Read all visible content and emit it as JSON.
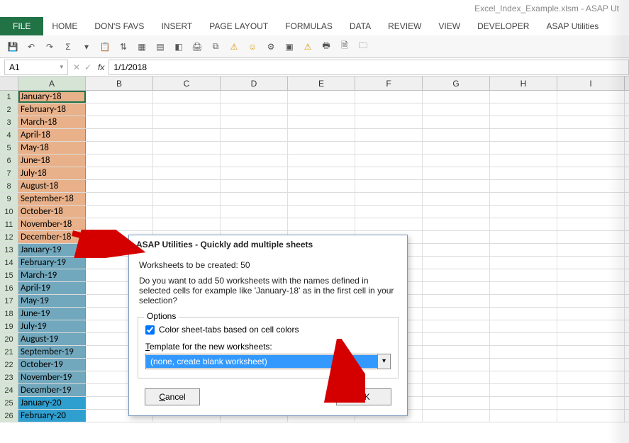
{
  "window": {
    "title": "Excel_Index_Example.xlsm - ASAP Ut"
  },
  "ribbon": {
    "tabs": [
      "FILE",
      "HOME",
      "DON'S FAVS",
      "INSERT",
      "PAGE LAYOUT",
      "FORMULAS",
      "DATA",
      "REVIEW",
      "VIEW",
      "DEVELOPER",
      "ASAP Utilities"
    ]
  },
  "formula": {
    "namebox": "A1",
    "fx_label": "fx",
    "value": "1/1/2018"
  },
  "columns": [
    "A",
    "B",
    "C",
    "D",
    "E",
    "F",
    "G",
    "H",
    "I"
  ],
  "rows": [
    {
      "n": 1,
      "v": "January-18",
      "c": "orange",
      "active": true
    },
    {
      "n": 2,
      "v": "February-18",
      "c": "orange"
    },
    {
      "n": 3,
      "v": "March-18",
      "c": "orange"
    },
    {
      "n": 4,
      "v": "April-18",
      "c": "orange"
    },
    {
      "n": 5,
      "v": "May-18",
      "c": "orange"
    },
    {
      "n": 6,
      "v": "June-18",
      "c": "orange"
    },
    {
      "n": 7,
      "v": "July-18",
      "c": "orange"
    },
    {
      "n": 8,
      "v": "August-18",
      "c": "orange"
    },
    {
      "n": 9,
      "v": "September-18",
      "c": "orange"
    },
    {
      "n": 10,
      "v": "October-18",
      "c": "orange"
    },
    {
      "n": 11,
      "v": "November-18",
      "c": "orange"
    },
    {
      "n": 12,
      "v": "December-18",
      "c": "orange"
    },
    {
      "n": 13,
      "v": "January-19",
      "c": "blue1"
    },
    {
      "n": 14,
      "v": "February-19",
      "c": "blue1"
    },
    {
      "n": 15,
      "v": "March-19",
      "c": "blue1"
    },
    {
      "n": 16,
      "v": "April-19",
      "c": "blue1"
    },
    {
      "n": 17,
      "v": "May-19",
      "c": "blue1"
    },
    {
      "n": 18,
      "v": "June-19",
      "c": "blue1"
    },
    {
      "n": 19,
      "v": "July-19",
      "c": "blue1"
    },
    {
      "n": 20,
      "v": "August-19",
      "c": "blue1"
    },
    {
      "n": 21,
      "v": "September-19",
      "c": "blue1"
    },
    {
      "n": 22,
      "v": "October-19",
      "c": "blue1"
    },
    {
      "n": 23,
      "v": "November-19",
      "c": "blue1"
    },
    {
      "n": 24,
      "v": "December-19",
      "c": "blue1"
    },
    {
      "n": 25,
      "v": "January-20",
      "c": "blue2"
    },
    {
      "n": 26,
      "v": "February-20",
      "c": "blue2"
    }
  ],
  "dialog": {
    "title": "ASAP Utilities - Quickly add multiple sheets",
    "line1": "Worksheets to be created: 50",
    "line2": "Do you want to add 50 worksheets with the names defined in selected cells for example like 'January-18' as in the first cell in your selection?",
    "options_legend": "Options",
    "checkbox_label": "Color sheet-tabs based on cell colors",
    "checkbox_checked": true,
    "template_label": "Template for the new worksheets:",
    "template_value": "(none, create blank worksheet)",
    "cancel": "Cancel",
    "ok": "OK"
  }
}
